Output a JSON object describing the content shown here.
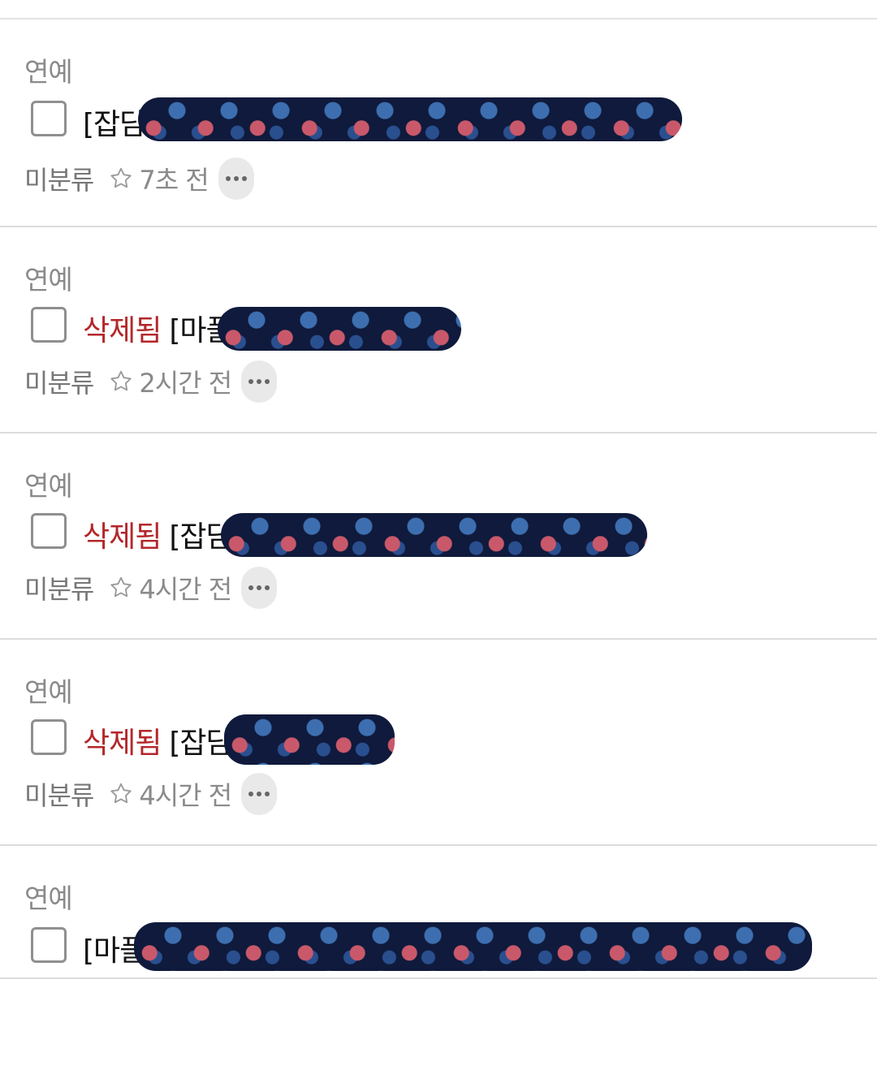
{
  "posts": [
    {
      "category": "연예",
      "deleted_label": "",
      "title": "[잡담]",
      "board": "미분류",
      "time": "7초 전",
      "redact_width": 670
    },
    {
      "category": "연예",
      "deleted_label": "삭제됨",
      "title": "[마플]",
      "board": "미분류",
      "time": "2시간 전",
      "redact_width": 300
    },
    {
      "category": "연예",
      "deleted_label": "삭제됨",
      "title": "[잡담]",
      "board": "미분류",
      "time": "4시간 전",
      "redact_width": 525
    },
    {
      "category": "연예",
      "deleted_label": "삭제됨",
      "title": "[잡담]",
      "board": "미분류",
      "time": "4시간 전",
      "redact_width": 210
    },
    {
      "category": "연예",
      "deleted_label": "",
      "title": "[마플",
      "board": "",
      "time": "",
      "redact_width": 835
    }
  ],
  "icons": {
    "favorite": "star-outline-icon",
    "more": "more-horizontal-icon"
  },
  "colors": {
    "deleted": "#b3272a",
    "muted": "#8a8a8a",
    "divider": "#dcdcdc"
  }
}
